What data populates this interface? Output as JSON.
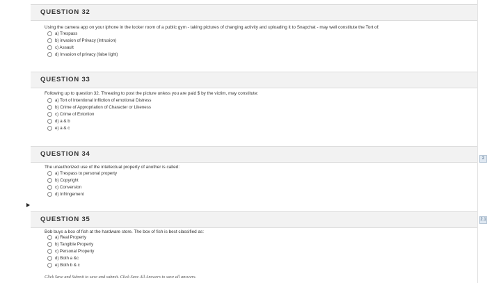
{
  "questions": [
    {
      "title": "QUESTION 32",
      "text": "Using the camera app on your iphone in the locker room of a public gym - taking pictures of changing activity and uploading it to Snapchat - may well constitute the Tort of:",
      "options": [
        "a) Trespass",
        "b) invasion of Privacy (Intrusion)",
        "c) Assault",
        "d) Invasion of privacy (false light)"
      ]
    },
    {
      "title": "QUESTION 33",
      "text": "Following up to question 32. Threating to post the picture unless you are paid $ by the victim, may constitute:",
      "options": [
        "a) Tort of Intentional Infliction of emotional Distress",
        "b) Crime of Appropriation of Character or Likeness",
        "c) Crime of Extortion",
        "d) a & b",
        "e) a & c"
      ]
    },
    {
      "title": "QUESTION 34",
      "text": "The unauthorized use of the intellectual property of another is called:",
      "options": [
        "a) Trespass to personal property",
        "b) Copyright",
        "c) Conversion",
        "d) Infringement"
      ]
    },
    {
      "title": "QUESTION 35",
      "text": "Bob buys a box of fish at the hardware store. The box of fish is best classified as:",
      "options": [
        "a) Real Property",
        "b) Tangible Property",
        "c) Personal Property",
        "d) Both a &c",
        "e) Both b & c"
      ]
    }
  ],
  "rail_tags": [
    "2",
    "2.1"
  ],
  "footer": "Click Save and Submit to save and submit. Click Save All Answers to save all answers."
}
